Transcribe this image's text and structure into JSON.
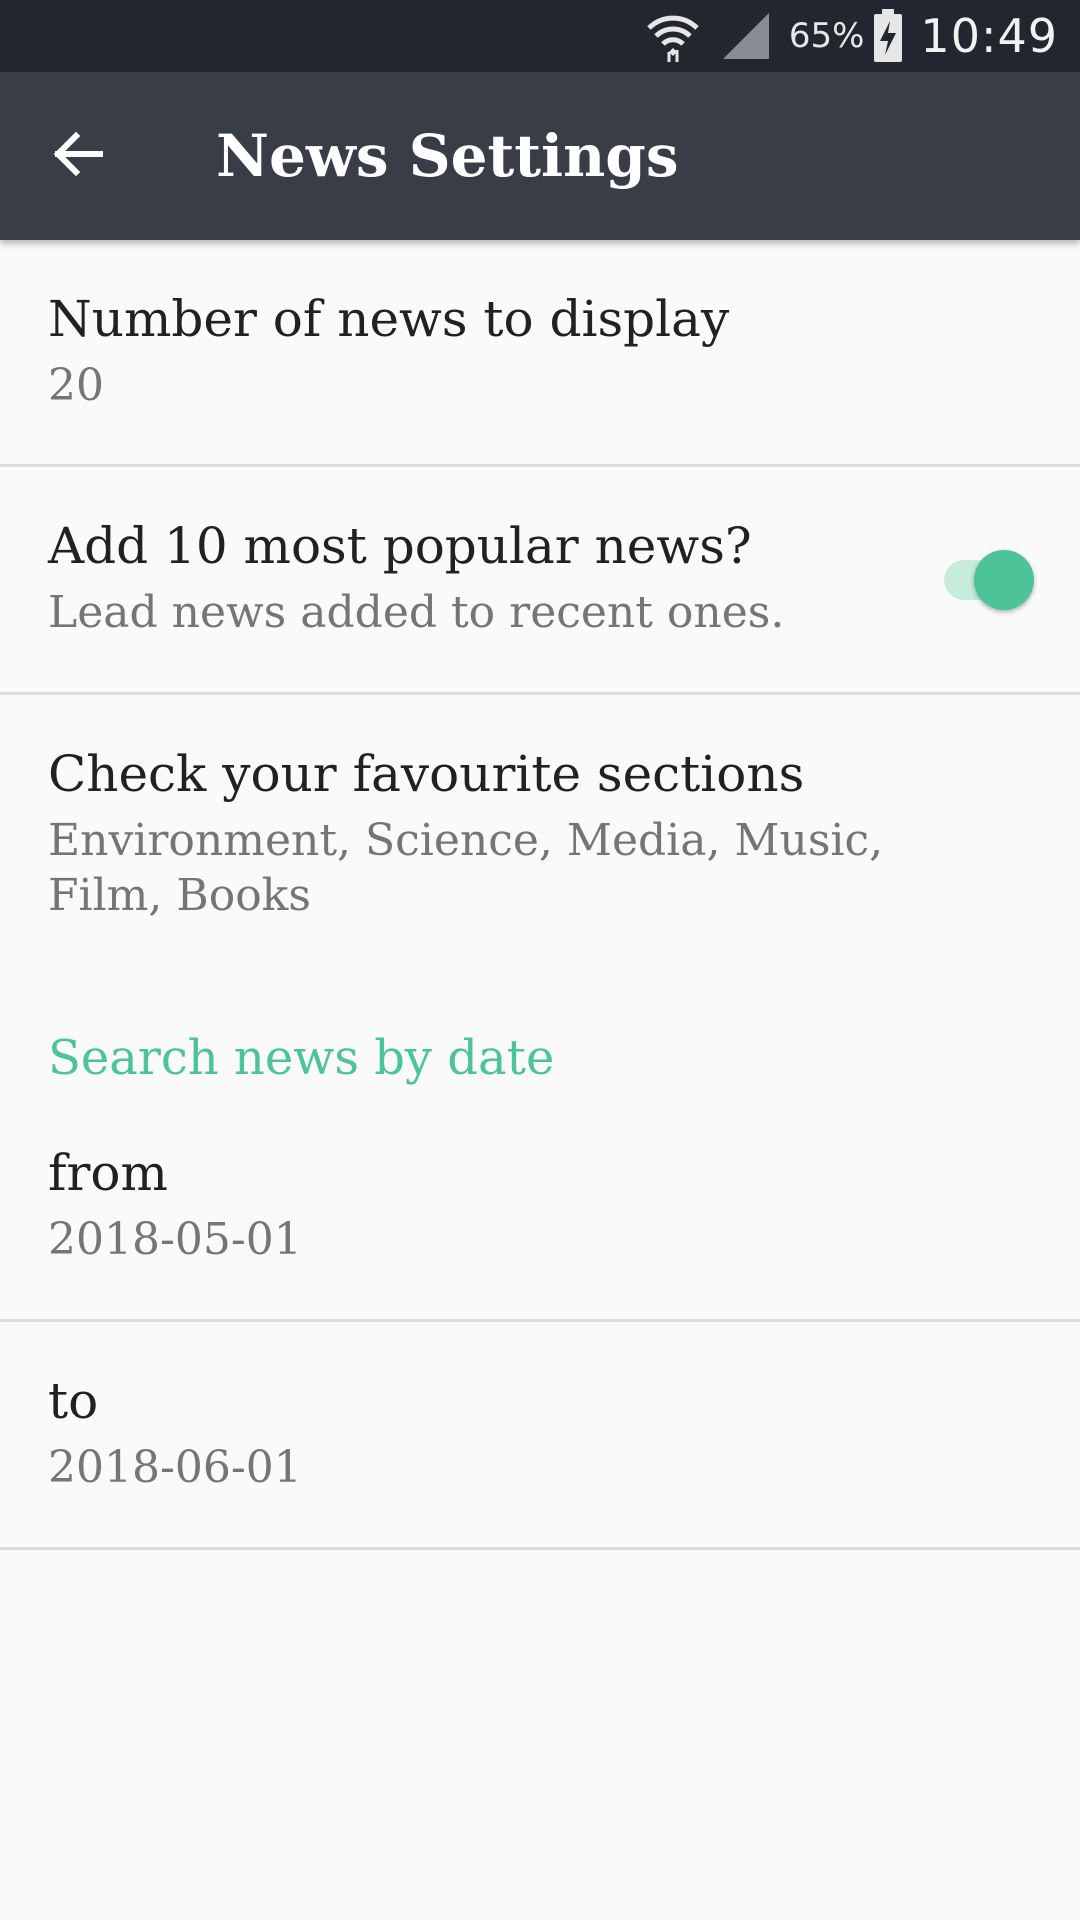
{
  "status_bar": {
    "battery_percent": "65%",
    "time": "10:49",
    "icons": [
      "wifi-icon",
      "cell-signal-icon",
      "battery-charging-icon"
    ]
  },
  "toolbar": {
    "back_icon": "arrow-left-icon",
    "title": "News Settings"
  },
  "preferences": {
    "news_count": {
      "title": "Number of news to display",
      "summary": "20"
    },
    "popular_news": {
      "title": "Add 10 most popular news?",
      "summary": "Lead news added to recent ones.",
      "enabled": true
    },
    "sections": {
      "title": "Check your favourite sections",
      "summary": "Environment, Science, Media, Music, Film, Books"
    }
  },
  "date_category": {
    "title": "Search news by date",
    "from": {
      "title": "from",
      "summary": "2018-05-01"
    },
    "to": {
      "title": "to",
      "summary": "2018-06-01"
    }
  },
  "colors": {
    "accent": "#4cc497",
    "toolbar": "#393d47",
    "status_bar": "#22262e",
    "background": "#fafafa"
  }
}
